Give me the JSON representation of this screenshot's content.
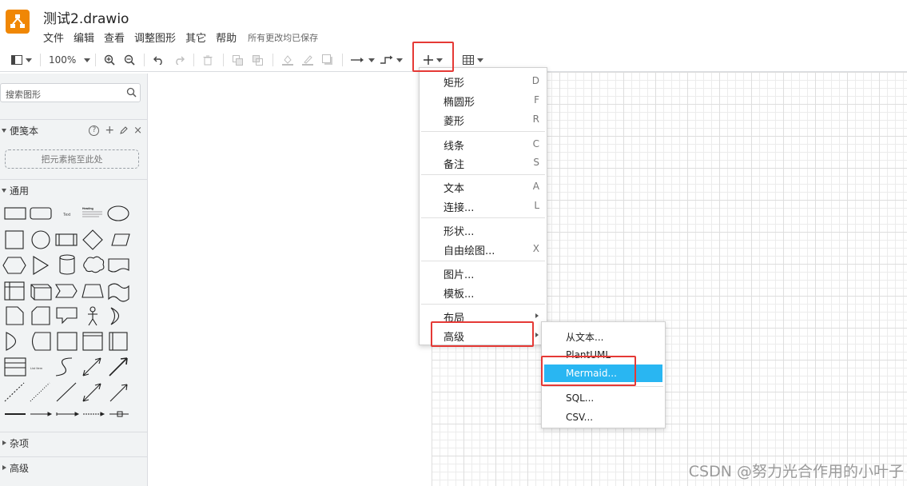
{
  "app": {
    "title": "测试2.drawio",
    "save_status": "所有更改均已保存",
    "accent": "#f08705"
  },
  "menubar": {
    "items": [
      "文件",
      "编辑",
      "查看",
      "调整图形",
      "其它",
      "帮助"
    ]
  },
  "toolbar": {
    "zoom": "100%",
    "icons": [
      "sidebar-toggle-icon",
      "zoom-in-icon",
      "zoom-out-icon",
      "undo-icon",
      "redo-icon",
      "delete-icon",
      "to-front-icon",
      "to-back-icon",
      "fill-color-icon",
      "line-color-icon",
      "shadow-icon",
      "connection-icon",
      "waypoints-icon",
      "insert-plus-icon",
      "table-icon"
    ]
  },
  "sidebar": {
    "search_placeholder": "搜索图形",
    "scratchpad": {
      "title": "便笺本",
      "dropzone": "把元素拖至此处",
      "help": "?",
      "add": "+",
      "close": "×"
    },
    "general": {
      "title": "通用",
      "text_shape": "Text",
      "heading_shape": "Heading",
      "list_shape": "List Item"
    },
    "misc": {
      "title": "杂项"
    },
    "advanced": {
      "title": "高级"
    }
  },
  "insert_menu": {
    "items": [
      {
        "label": "矩形",
        "key": "D"
      },
      {
        "label": "椭圆形",
        "key": "F"
      },
      {
        "label": "菱形",
        "key": "R"
      },
      {
        "label": "线条",
        "key": "C"
      },
      {
        "label": "备注",
        "key": "S"
      },
      {
        "label": "文本",
        "key": "A"
      },
      {
        "label": "连接...",
        "key": "L"
      },
      {
        "label": "形状...",
        "key": ""
      },
      {
        "label": "自由绘图...",
        "key": "X"
      },
      {
        "label": "图片...",
        "key": ""
      },
      {
        "label": "模板...",
        "key": ""
      },
      {
        "label": "布局",
        "key": ""
      },
      {
        "label": "高级",
        "key": ""
      }
    ]
  },
  "advanced_submenu": {
    "items": [
      "从文本...",
      "PlantUML",
      "Mermaid...",
      "SQL...",
      "CSV..."
    ],
    "selected": "Mermaid...",
    "highlight_color": "#29b6f2"
  },
  "annotations": {
    "box_color": "#e53935"
  },
  "watermark": "CSDN @努力光合作用的小叶子"
}
